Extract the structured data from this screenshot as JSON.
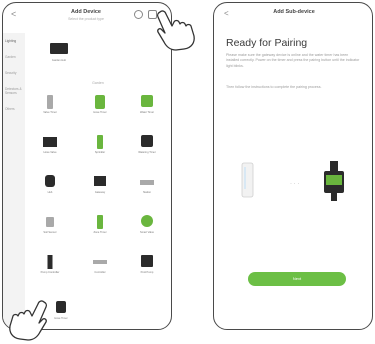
{
  "left": {
    "title": "Add Device",
    "subtitle": "Select the product type",
    "sidebar": [
      "Lighting",
      "Garden",
      "Security",
      "Detectors & Sensors",
      "Others"
    ],
    "section_label": "Garden",
    "top_device": "Garden Hub",
    "devices": [
      [
        "Valve Timer",
        "Hose Timer",
        "Water Timer"
      ],
      [
        "Hose Valve",
        "Sprinkler",
        "Watering Timer"
      ],
      [
        "Hub",
        "Gateway",
        "Station"
      ],
      [
        "Soil Sensor",
        "Zone Timer",
        "Smart Valve"
      ],
      [
        "Pump Controller",
        "Controller",
        "Pool Pump"
      ],
      [
        "Hose Timer"
      ]
    ]
  },
  "right": {
    "title": "Add Sub-device",
    "heading": "Ready for Pairing",
    "paragraph1": "Please make sure the gateway device is online and the water timer has been installed correctly. Power on the timer and press the pairing button until the indicator light blinks.",
    "paragraph2": "Then follow the instructions to complete the pairing process.",
    "next_button": "Next"
  },
  "colors": {
    "accent": "#6cbf45"
  },
  "icons": [
    "back-arrow-icon",
    "search-icon",
    "scan-icon",
    "dots-icon",
    "hand-pointer-icon"
  ]
}
